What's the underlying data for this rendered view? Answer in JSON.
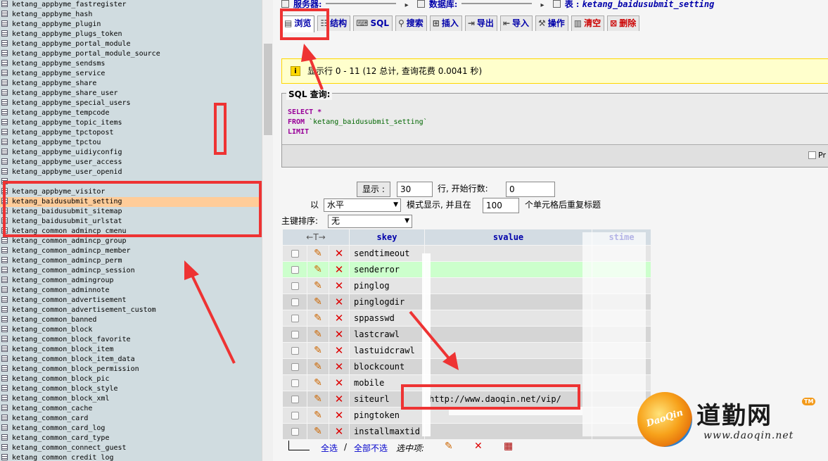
{
  "left_nav": {
    "tables": [
      "ketang_appbyme_fastregister",
      "ketang_appbyme_hash",
      "ketang_appbyme_plugin",
      "ketang_appbyme_plugs_token",
      "ketang_appbyme_portal_module",
      "ketang_appbyme_portal_module_source",
      "ketang_appbyme_sendsms",
      "ketang_appbyme_service",
      "ketang_appbyme_share",
      "ketang_appbyme_share_user",
      "ketang_appbyme_special_users",
      "ketang_appbyme_tempcode",
      "ketang_appbyme_topic_items",
      "ketang_appbyme_tpctopost",
      "ketang_appbyme_tpctou",
      "ketang_appbyme_uidiyconfig",
      "ketang_appbyme_user_access",
      "ketang_appbyme_user_openid",
      "",
      "ketang_appbyme_visitor",
      "ketang_baidusubmit_setting",
      "ketang_baidusubmit_sitemap",
      "ketang_baidusubmit_urlstat",
      "ketang_common_admincp_cmenu",
      "ketang_common_admincp_group",
      "ketang_common_admincp_member",
      "ketang_common_admincp_perm",
      "ketang_common_admincp_session",
      "ketang_common_admingroup",
      "ketang_common_adminnote",
      "ketang_common_advertisement",
      "ketang_common_advertisement_custom",
      "ketang_common_banned",
      "ketang_common_block",
      "ketang_common_block_favorite",
      "ketang_common_block_item",
      "ketang_common_block_item_data",
      "ketang_common_block_permission",
      "ketang_common_block_pic",
      "ketang_common_block_style",
      "ketang_common_block_xml",
      "ketang_common_cache",
      "ketang_common_card",
      "ketang_common_card_log",
      "ketang_common_card_type",
      "ketang_common_connect_guest",
      "ketang_common_credit_log"
    ],
    "selected_table": "ketang_baidusubmit_setting"
  },
  "header": {
    "server_label": "服务器:",
    "database_label": "数据库:",
    "table_label": "表 :",
    "table_name": "ketang_baidusubmit_setting"
  },
  "tabs": [
    {
      "label": "浏览",
      "icon": "browse-icon",
      "glyph": "▤"
    },
    {
      "label": "结构",
      "icon": "structure-icon",
      "glyph": "☷"
    },
    {
      "label": "SQL",
      "icon": "sql-icon",
      "glyph": "⌨"
    },
    {
      "label": "搜索",
      "icon": "search-icon",
      "glyph": "⚲"
    },
    {
      "label": "插入",
      "icon": "insert-icon",
      "glyph": "⊞"
    },
    {
      "label": "导出",
      "icon": "export-icon",
      "glyph": "⇥"
    },
    {
      "label": "导入",
      "icon": "import-icon",
      "glyph": "⇤"
    },
    {
      "label": "操作",
      "icon": "operations-icon",
      "glyph": "⚒"
    },
    {
      "label": "清空",
      "icon": "empty-icon",
      "glyph": "▥"
    },
    {
      "label": "删除",
      "icon": "drop-icon",
      "glyph": "⊠"
    }
  ],
  "message": {
    "text": "显示行 0 - 11 (12 总计, 查询花费 0.0041 秒)"
  },
  "sql_query": {
    "legend": "SQL 查询:",
    "select_kw": "SELECT",
    "select_rest": " *",
    "from_kw": "FROM",
    "from_table": " `ketang_baidusubmit_setting`",
    "limit_kw": "LIMIT",
    "profiling_label": "Pr"
  },
  "nav_form": {
    "show_button": "显示 :",
    "rows_value": "30",
    "start_row_label": "行, 开始行数:",
    "start_row_value": "0",
    "in_label": "以",
    "mode_value": "水平",
    "mode_suffix": "模式显示, 并且在",
    "repeat_value": "100",
    "repeat_suffix": "个单元格后重复标题",
    "sort_label": "主键排序:",
    "sort_value": "无"
  },
  "table": {
    "nav_header": "←T→",
    "columns": [
      "skey",
      "svalue",
      "stime"
    ],
    "rows": [
      {
        "skey": "sendtimeout",
        "svalue": ""
      },
      {
        "skey": "senderror",
        "svalue": ""
      },
      {
        "skey": "pinglog",
        "svalue": ""
      },
      {
        "skey": "pinglogdir",
        "svalue": ""
      },
      {
        "skey": "sppasswd",
        "svalue": ""
      },
      {
        "skey": "lastcrawl",
        "svalue": ""
      },
      {
        "skey": "lastuidcrawl",
        "svalue": ""
      },
      {
        "skey": "blockcount",
        "svalue": ""
      },
      {
        "skey": "mobile",
        "svalue": ""
      },
      {
        "skey": "siteurl",
        "svalue": "http://www.daoqin.net/vip/"
      },
      {
        "skey": "pingtoken",
        "svalue": ""
      },
      {
        "skey": "installmaxtid",
        "svalue": ""
      }
    ]
  },
  "bottom_bar": {
    "check_all": "全选",
    "separator": "/",
    "uncheck_all": "全部不选",
    "with_selected": "选中项:"
  },
  "watermark": {
    "logo_text": "DaoQin",
    "brand": "道勤网",
    "tm": "TM",
    "url": "www.daoqin.net"
  },
  "colors": {
    "annotation_red": "#ee3333",
    "selected_row": "#ffcc99",
    "highlight_row": "#ccffcc",
    "nav_background": "#d0dce0"
  }
}
